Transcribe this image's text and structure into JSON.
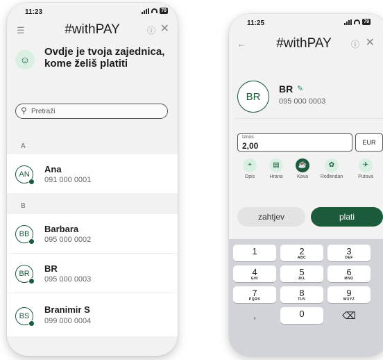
{
  "left": {
    "time": "11:23",
    "battery": "79",
    "title": "#withPAY",
    "heading": "Ovdje je tvoja zajednica, kome želiš platiti",
    "search_placeholder": "Pretraži",
    "sections": [
      {
        "letter": "A",
        "contacts": [
          {
            "initials": "AN",
            "name": "Ana",
            "phone": "091 000 0001"
          }
        ]
      },
      {
        "letter": "B",
        "contacts": [
          {
            "initials": "BB",
            "name": "Barbara",
            "phone": "095 000 0002"
          },
          {
            "initials": "BR",
            "name": "BR",
            "phone": "095 000 0003"
          },
          {
            "initials": "BS",
            "name": "Branimir S",
            "phone": "099 000 0004"
          }
        ]
      }
    ]
  },
  "right": {
    "time": "11:25",
    "battery": "79",
    "title": "#withPAY",
    "recipient": {
      "initials": "BR",
      "name": "BR",
      "phone": "095 000 0003"
    },
    "amount_label": "Iznos",
    "amount_value": "2,00",
    "currency": "EUR",
    "categories": [
      {
        "label": "Opis",
        "icon": "+"
      },
      {
        "label": "Hrana",
        "icon": "▤"
      },
      {
        "label": "Kava",
        "icon": "☕"
      },
      {
        "label": "Rođendan",
        "icon": "✿"
      },
      {
        "label": "Putova",
        "icon": "✈"
      }
    ],
    "active_category": "Kava",
    "request_label": "zahtjev",
    "pay_label": "plati",
    "keypad": [
      {
        "digit": "1",
        "letters": ""
      },
      {
        "digit": "2",
        "letters": "ABC"
      },
      {
        "digit": "3",
        "letters": "DEF"
      },
      {
        "digit": "4",
        "letters": "GHI"
      },
      {
        "digit": "5",
        "letters": "JKL"
      },
      {
        "digit": "6",
        "letters": "MNO"
      },
      {
        "digit": "7",
        "letters": "PQRS"
      },
      {
        "digit": "8",
        "letters": "TUV"
      },
      {
        "digit": "9",
        "letters": "WXYZ"
      },
      {
        "digit": ",",
        "letters": ""
      },
      {
        "digit": "0",
        "letters": ""
      }
    ]
  },
  "colors": {
    "brand_green": "#1c5a3c",
    "light_green": "#d9efe2",
    "keypad_bg": "#d1d3d9"
  }
}
